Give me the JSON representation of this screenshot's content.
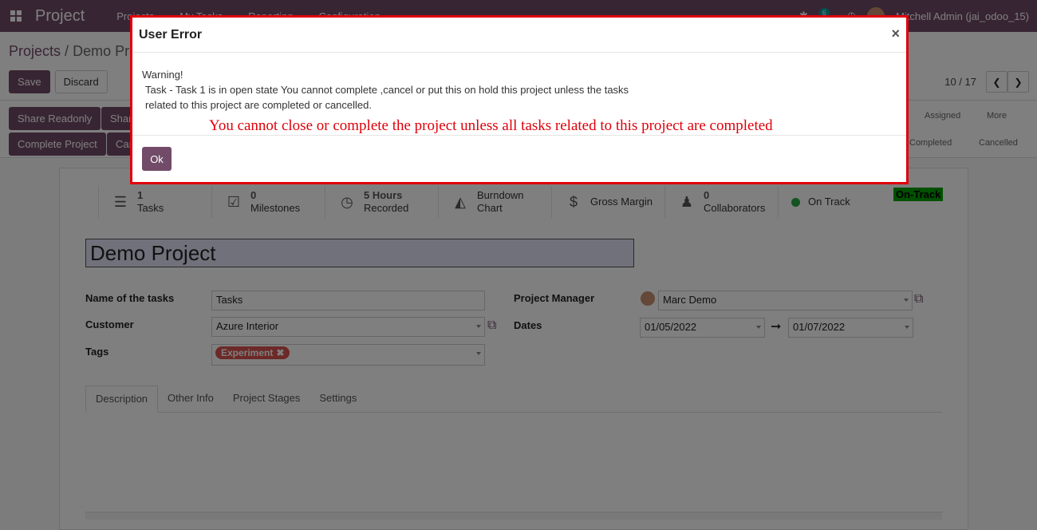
{
  "topbar": {
    "brand": "Project",
    "menu": [
      "Projects",
      "My Tasks",
      "Reporting",
      "Configuration"
    ],
    "notification_count": "6",
    "user": "Mitchell Admin (jai_odoo_15)"
  },
  "breadcrumb": {
    "parent": "Projects",
    "separator": "/",
    "current": "Demo Project"
  },
  "actions": {
    "save": "Save",
    "discard": "Discard"
  },
  "pager": {
    "value": "10 / 17"
  },
  "header_buttons": [
    "Share Readonly",
    "Share Editable",
    "Complete Project",
    "Cancel"
  ],
  "stages": {
    "row1": [
      "Assigned",
      "More"
    ],
    "row2": [
      "Completed",
      "Cancelled"
    ]
  },
  "stats": [
    {
      "num": "1",
      "label": "Tasks",
      "icon": "tasks-icon"
    },
    {
      "num": "0",
      "label": "Milestones",
      "icon": "check-icon"
    },
    {
      "num": "5 Hours",
      "label": "Recorded",
      "icon": "clock-icon"
    },
    {
      "num": "Burndown",
      "label": "Chart",
      "icon": "area-chart-icon"
    },
    {
      "num": "",
      "label": "Gross Margin",
      "icon": "dollar-icon"
    },
    {
      "num": "0",
      "label": "Collaborators",
      "icon": "users-icon"
    },
    {
      "num": "",
      "label": "On Track",
      "icon": "status-dot-icon"
    }
  ],
  "on_track_tag": "On-Track",
  "project_name": "Demo Project",
  "fields": {
    "name_of_tasks_label": "Name of the tasks",
    "name_of_tasks_value": "Tasks",
    "customer_label": "Customer",
    "customer_value": "Azure Interior",
    "tags_label": "Tags",
    "tag_value": "Experiment",
    "manager_label": "Project Manager",
    "manager_value": "Marc Demo",
    "dates_label": "Dates",
    "date_start": "01/05/2022",
    "date_end": "01/07/2022"
  },
  "tabs": [
    "Description",
    "Other Info",
    "Project Stages",
    "Settings"
  ],
  "modal": {
    "title": "User Error",
    "close": "×",
    "line1": "Warning!",
    "line2": "Task - Task 1 is in open state You cannot complete ,cancel or put this on hold this project unless the tasks",
    "line3": "related to this project are completed or cancelled.",
    "annotation": "You cannot close or complete the project unless all tasks related to this project are completed",
    "ok": "Ok",
    "highlight_color": "#e0000a"
  }
}
